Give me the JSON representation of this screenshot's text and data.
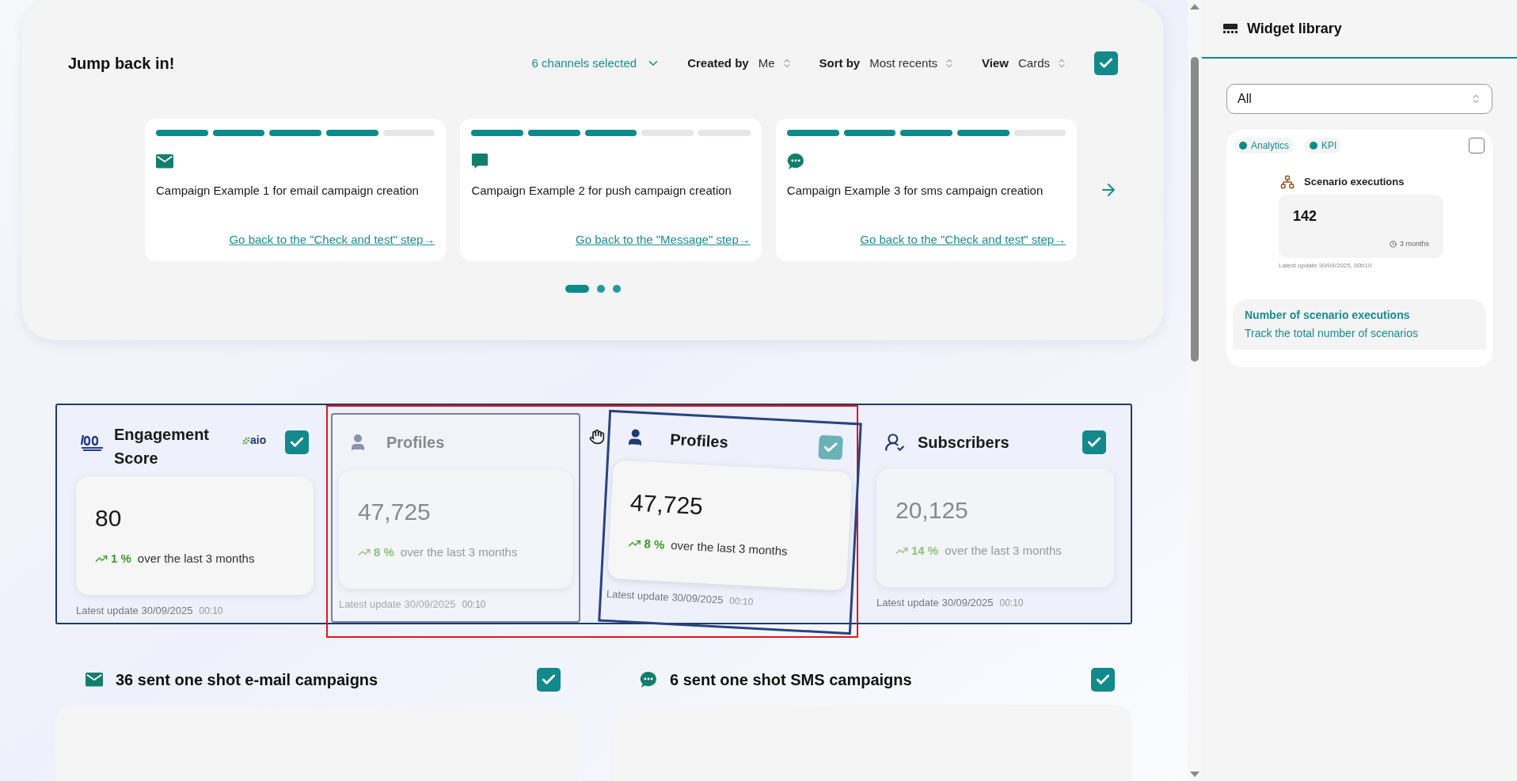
{
  "jump_back": {
    "title": "Jump back in!",
    "channels": "6 channels selected",
    "created_by": {
      "label": "Created by",
      "value": "Me"
    },
    "sort_by": {
      "label": "Sort by",
      "value": "Most recents"
    },
    "view": {
      "label": "View",
      "value": "Cards"
    },
    "checked": true,
    "campaigns": [
      {
        "kind": "email",
        "level": 0.8,
        "title": "Campaign Example 1 for email campaign creation",
        "link": "Go back to the \"Check and test\" step→"
      },
      {
        "kind": "push",
        "level": 0.6,
        "title": "Campaign Example 2 for push campaign creation",
        "link": "Go back to the \"Message\" step→"
      },
      {
        "kind": "sms",
        "level": 0.8,
        "title": "Campaign Example 3 for sms campaign creation",
        "link": "Go back to the \"Check and test\" step→"
      }
    ],
    "pages": [
      {
        "selected": true
      },
      {
        "selected": false
      },
      {
        "selected": false
      }
    ]
  },
  "widgets": [
    {
      "kind": "engagement",
      "title": "Engagement Score",
      "badge": "aio",
      "checked": true,
      "value": "80",
      "trend": "1 %",
      "trend_text": "over the last 3 months",
      "update_label": "Latest update",
      "date": "30/09/2025",
      "time": "00:10"
    },
    {
      "kind": "placeholder",
      "title": "Profiles",
      "value": "47,725",
      "trend": "8 %",
      "trend_text": "over the last 3 months",
      "update_label": "Latest update",
      "date": "30/09/2025",
      "time": "00:10"
    },
    {
      "kind": "subscribers",
      "title": "Subscribers",
      "checked": true,
      "value": "20,125",
      "trend": "14 %",
      "trend_text": "over the last 3 months",
      "update_label": "Latest update",
      "date": "30/09/2025",
      "time": "00:10"
    }
  ],
  "dragged_widget": {
    "title": "Profiles",
    "checked": true,
    "value": "47,725",
    "trend": "8 %",
    "trend_text": "over the last 3 months",
    "update_label": "Latest update",
    "date": "30/09/2025",
    "time": "00:10"
  },
  "campaign_sections": [
    {
      "kind": "email",
      "title": "36 sent one shot e-mail campaigns",
      "checked": true
    },
    {
      "kind": "sms",
      "title": "6 sent one shot SMS campaigns",
      "checked": true
    }
  ],
  "widget_library": {
    "title": "Widget library",
    "filter": "All",
    "items": [
      {
        "tags": [
          {
            "label": "Analytics",
            "color": "#0e8a8a"
          },
          {
            "label": "KPI",
            "color": "#0e8a8a"
          }
        ],
        "checked": false,
        "name": "Scenario executions",
        "value": "142",
        "period": "3 months",
        "update": "Latest update 30/09/2025, 00h10",
        "heading": "Number of scenario executions",
        "description": "Track the total number of scenarios"
      }
    ]
  }
}
